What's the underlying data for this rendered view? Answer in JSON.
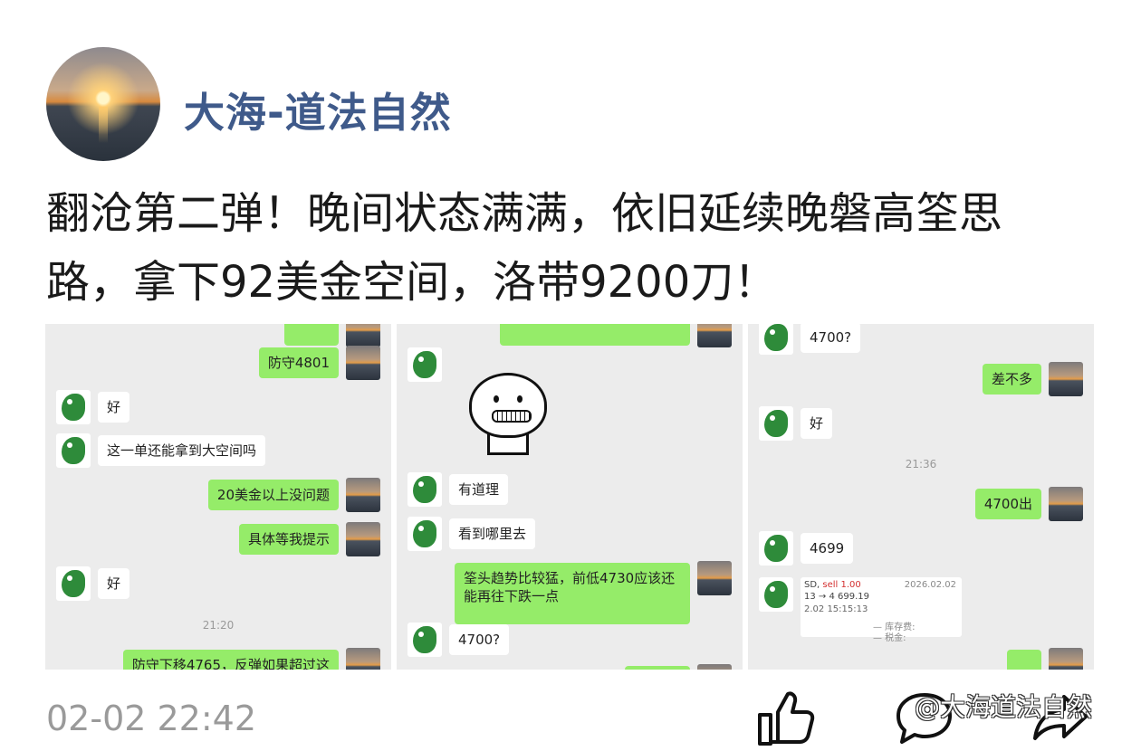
{
  "post": {
    "username": "大海-道法自然",
    "text": "翻沧第二弹！晚间状态满满，依旧延续晚磐高筌思路，拿下92美金空间，洛带9200刀！",
    "timestamp": "02-02 22:42"
  },
  "screenshots": {
    "p1": {
      "messages": [
        {
          "side": "out",
          "text": "防守4801"
        },
        {
          "side": "in",
          "text": "好"
        },
        {
          "side": "in",
          "text": "这一单还能拿到大空间吗"
        },
        {
          "side": "out",
          "text": "20美金以上没问题"
        },
        {
          "side": "out",
          "text": "具体等我提示"
        },
        {
          "side": "in",
          "text": "好"
        },
        {
          "side": "out",
          "text": "防守下移4765，反弹如果超过这"
        }
      ],
      "time": "21:20"
    },
    "p2": {
      "messages": [
        {
          "side": "in",
          "text": "有道理"
        },
        {
          "side": "in",
          "text": "看到哪里去"
        },
        {
          "side": "out",
          "text": "筌头趋势比较猛，前低4730应该还能再往下跌一点"
        },
        {
          "side": "in",
          "text": "4700?"
        }
      ]
    },
    "p3": {
      "messages": [
        {
          "side": "in",
          "text": "4700?"
        },
        {
          "side": "out",
          "text": "差不多"
        },
        {
          "side": "in",
          "text": "好"
        },
        {
          "side": "out",
          "text": "4700出"
        },
        {
          "side": "in",
          "text": "4699"
        }
      ],
      "time": "21:36",
      "trade_card": {
        "line1_prefix": "SD, ",
        "line1_sell": "sell 1.00",
        "date": "2026.02.02",
        "line2": "13 → 4 699.19",
        "line3": "2.02 15:15:13",
        "line4": "—  库存费:",
        "line5": "—  税金:"
      }
    }
  },
  "actions": {
    "like_icon": "thumbs-up-icon",
    "comment_icon": "comment-icon",
    "share_icon": "share-icon"
  },
  "watermark": "@大海道法自然",
  "colors": {
    "username": "#3f5a8a",
    "bubble_out": "#95ec69",
    "chat_bg": "#ececec"
  }
}
